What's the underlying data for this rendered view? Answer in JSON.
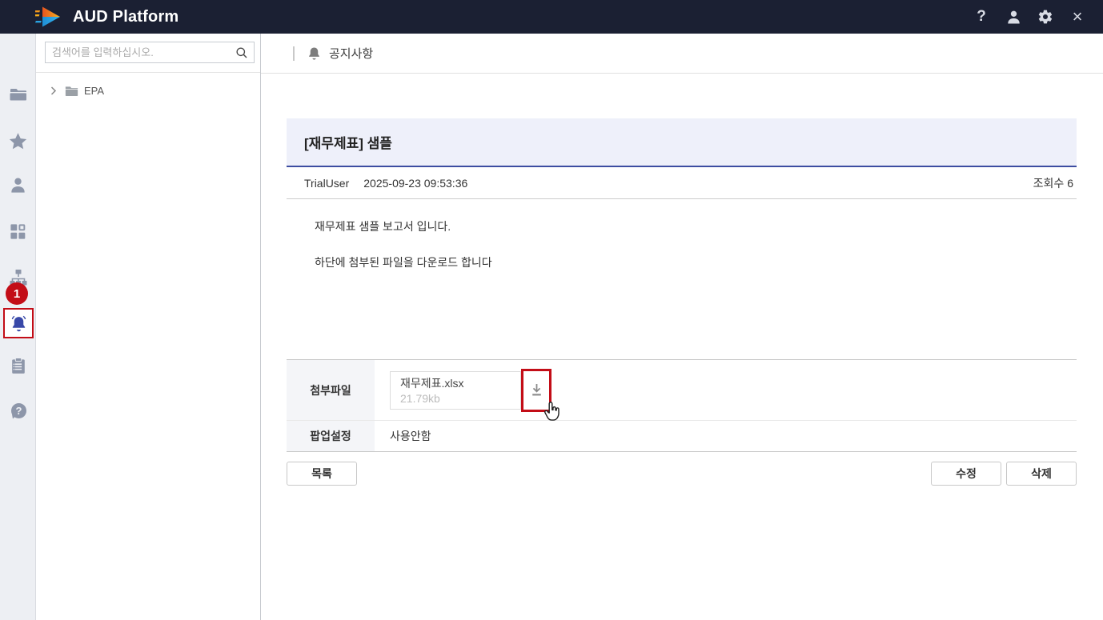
{
  "header": {
    "app_title": "AUD Platform",
    "help_glyph": "?",
    "close_glyph": "×",
    "icons": [
      "help-icon",
      "user-icon",
      "gear-icon",
      "close-icon"
    ]
  },
  "sidebar": {
    "icons": [
      "folder-icon",
      "star-icon",
      "user-icon",
      "apps-grid-icon",
      "org-chart-icon",
      "bell-icon",
      "clipboard-icon",
      "help-bubble-icon"
    ],
    "active_item": "bell",
    "badge_count": "1"
  },
  "tree": {
    "search_placeholder": "검색어를 입력하십시오.",
    "nodes": [
      {
        "label": "EPA"
      }
    ]
  },
  "page": {
    "title": "공지사항"
  },
  "notice": {
    "title": "[재무제표] 샘플",
    "author": "TrialUser",
    "datetime": "2025-09-23 09:53:36",
    "views_text": "조회수 6",
    "body_lines": [
      "재무제표 샘플 보고서 입니다.",
      "하단에 첨부된 파일을 다운로드 합니다"
    ],
    "attachment": {
      "label": "첨부파일",
      "file_name": "재무제표.xlsx",
      "file_size": "21.79kb"
    },
    "popup": {
      "label": "팝업설정",
      "value": "사용안함"
    }
  },
  "actions": {
    "list": "목록",
    "edit": "수정",
    "delete": "삭제"
  },
  "annotation": {
    "badge": "1",
    "color": "#c30d17"
  },
  "colors": {
    "topbar_bg": "#1b2033",
    "annotation_red": "#c30d17",
    "active_icon_blue": "#3848a8",
    "title_underline": "#3d4da1",
    "titlebar_bg": "#eef0fa"
  }
}
